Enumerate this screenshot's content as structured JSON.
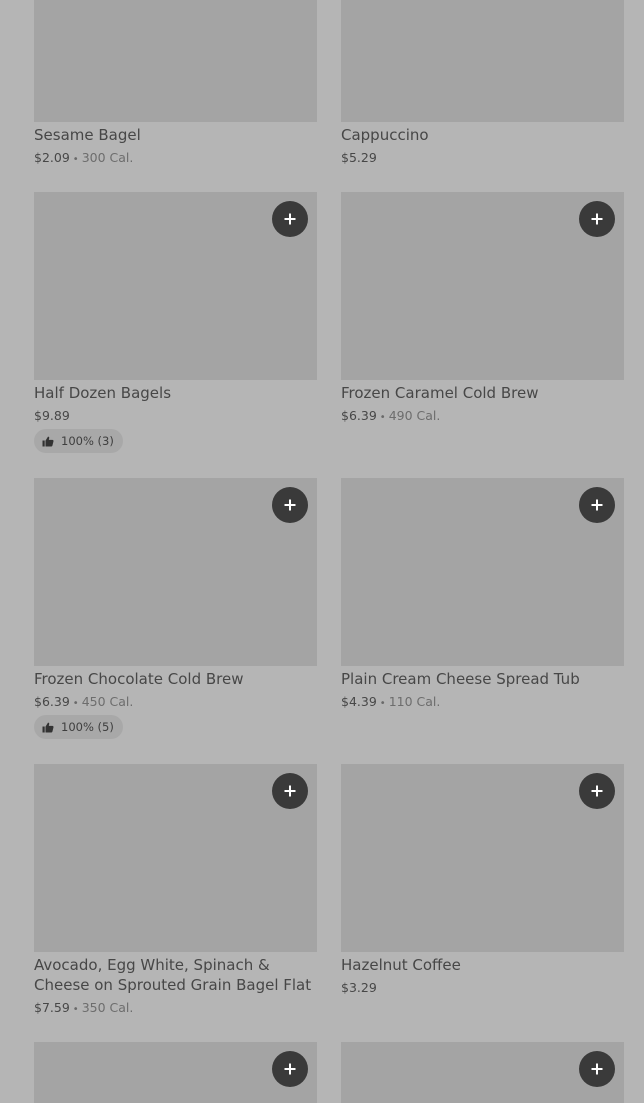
{
  "items": [
    {
      "name": "Sesame Bagel",
      "price": "$2.09",
      "calories": "300 Cal."
    },
    {
      "name": "Cappuccino",
      "price": "$5.29"
    },
    {
      "name": "Half Dozen Bagels",
      "price": "$9.89",
      "rating": "100% (3)"
    },
    {
      "name": "Frozen Caramel Cold Brew",
      "price": "$6.39",
      "calories": "490 Cal."
    },
    {
      "name": "Frozen Chocolate Cold Brew",
      "price": "$6.39",
      "calories": "450 Cal.",
      "rating": "100% (5)"
    },
    {
      "name": "Plain Cream Cheese Spread Tub",
      "price": "$4.39",
      "calories": "110 Cal."
    },
    {
      "name": "Avocado, Egg White, Spinach & Cheese on Sprouted Grain Bagel Flat",
      "price": "$7.59",
      "calories": "350 Cal."
    },
    {
      "name": "Hazelnut Coffee",
      "price": "$3.29"
    }
  ],
  "separator": "•",
  "icons": {
    "add": "plus-icon",
    "rating": "thumbs-up-icon"
  }
}
